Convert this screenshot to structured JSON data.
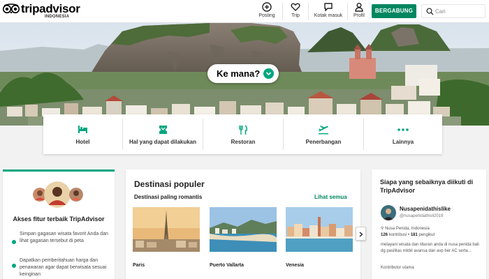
{
  "brand": {
    "name": "tripadvisor",
    "country": "INDONESIA",
    "accent": "#00a680",
    "button": "#00875f"
  },
  "nav": {
    "post": "Posting",
    "trip": "Trip",
    "inbox": "Kotak masuk",
    "profile": "Profil",
    "join": "BERGABUNG",
    "search_placeholder": "Cari"
  },
  "hero": {
    "cta": "Ke mana?"
  },
  "categories": [
    {
      "label": "Hotel",
      "icon": "bed-icon"
    },
    {
      "label": "Hal yang dapat dilakukan",
      "icon": "ticket-icon"
    },
    {
      "label": "Restoran",
      "icon": "cutlery-icon"
    },
    {
      "label": "Penerbangan",
      "icon": "plane-icon"
    },
    {
      "label": "Lainnya",
      "icon": "more-icon"
    }
  ],
  "left_card": {
    "title": "Akses fitur terbaik TripAdvisor",
    "bullets": [
      "Simpan gagasan wisata favorit Anda dan lihat gagasan tersebut di peta",
      "Dapatkan pemberitahuan harga dan penawaran agar dapat berwisata sesuai keinginan"
    ]
  },
  "popular": {
    "title": "Destinasi populer",
    "subtitle": "Destinasi paling romantis",
    "see_all": "Lihat semua",
    "destinations": [
      {
        "name": "Paris"
      },
      {
        "name": "Puerto Vallarta"
      },
      {
        "name": "Venesia"
      }
    ]
  },
  "follow": {
    "title": "Siapa yang sebaiknya diikuti di TripAdvisor",
    "user": {
      "name": "Nusapenidathislike",
      "handle": "@nusapenidathisli2019",
      "location": "Nusa Penida, Indonesia",
      "contributions": "126",
      "contributions_label": "kontribusi",
      "followers": "181",
      "followers_label": "pengikut",
      "description": "melayani wisata dan liburan anda di nusa penida bali dg pasilitas mkbil avansa dan avp ber AC serta...",
      "footer": "Kontributor utama"
    }
  }
}
